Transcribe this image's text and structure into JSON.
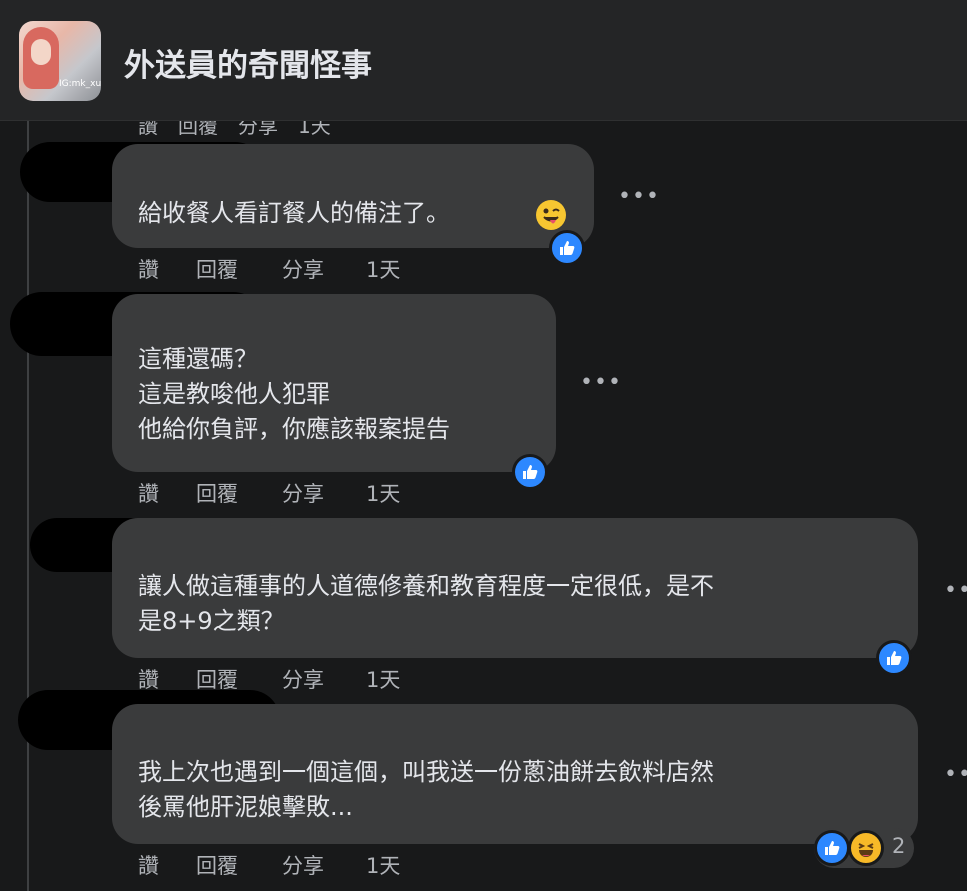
{
  "header": {
    "group_name": "外送員的奇聞怪事",
    "avatar_watermark": "IG:mk_xup"
  },
  "partial_actions": "讚　回覆　分享　1天",
  "comments": [
    {
      "text": "給收餐人看訂餐人的備注了。",
      "emoji": "tongue-out-wink-emoji",
      "reaction": "like",
      "actions": {
        "like": "讚",
        "reply": "回覆",
        "share": "分享",
        "time": "1天"
      }
    },
    {
      "text": "這種還碼？\n這是教唆他人犯罪\n他給你負評，你應該報案提告",
      "reaction": "like",
      "actions": {
        "like": "讚",
        "reply": "回覆",
        "share": "分享",
        "time": "1天"
      }
    },
    {
      "text": "讓人做這種事的人道德修養和教育程度一定很低，是不\n是8+9之類？",
      "reaction": "like",
      "actions": {
        "like": "讚",
        "reply": "回覆",
        "share": "分享",
        "time": "1天"
      }
    },
    {
      "text": "我上次也遇到一個這個，叫我送一份蔥油餅去飲料店然\n後罵他肝泥娘擊敗...",
      "reaction": "like+haha",
      "reaction_count": "2",
      "actions": {
        "like": "讚",
        "reply": "回覆",
        "share": "分享",
        "time": "1天"
      }
    }
  ],
  "colors": {
    "background": "#18191a",
    "bubble": "#3a3b3c",
    "text": "#e4e6eb",
    "secondary_text": "#b0b3b8",
    "like_blue": "#2d88ff",
    "haha_yellow": "#f7b928"
  }
}
